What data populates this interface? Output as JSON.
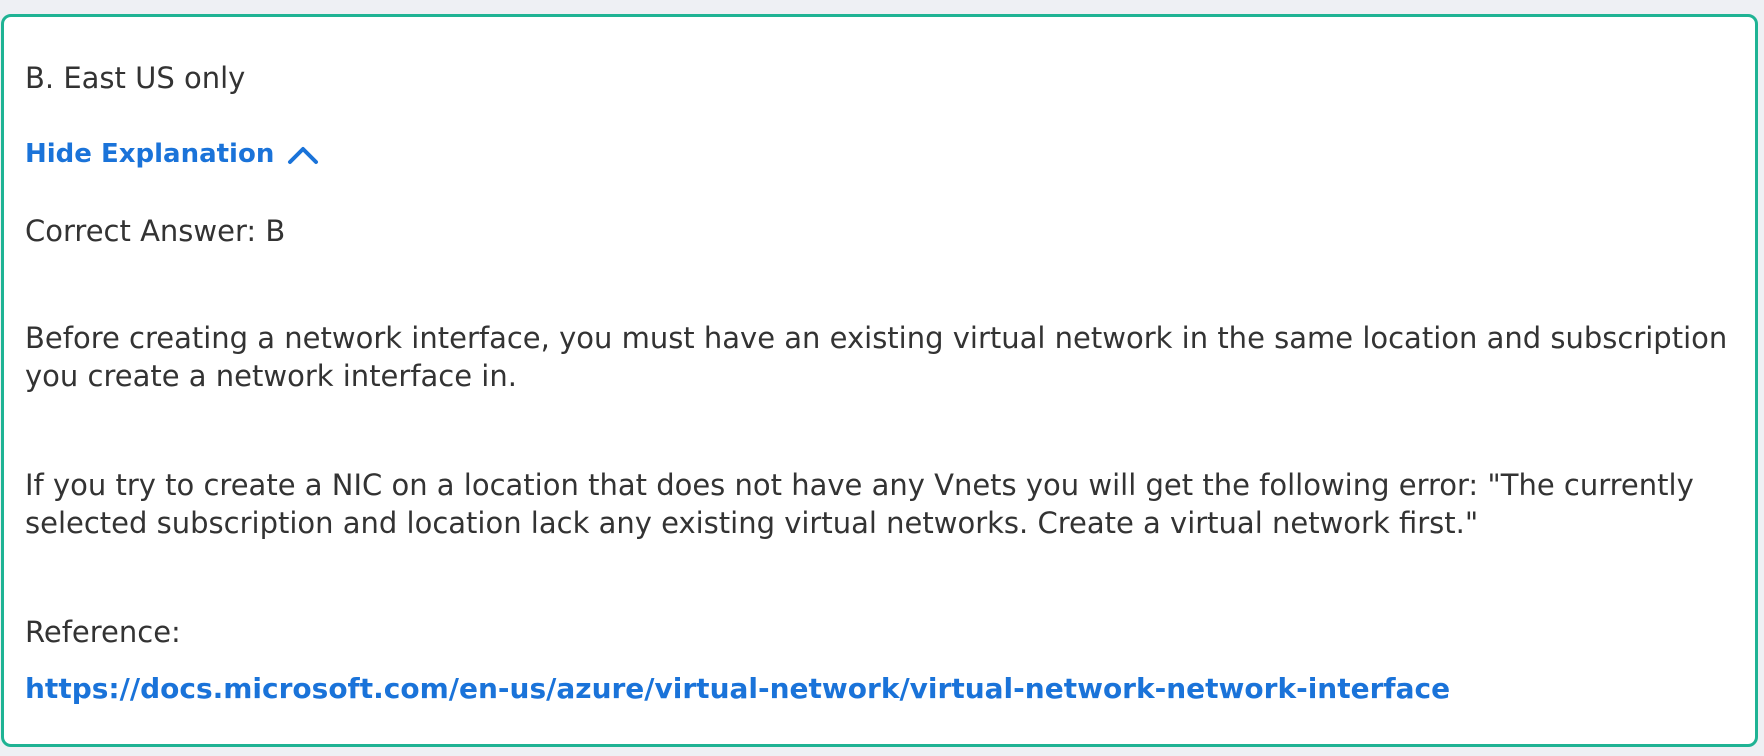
{
  "answer_option": "B. East US only",
  "toggle": {
    "label": "Hide Explanation",
    "icon": "chevron-up-icon"
  },
  "correct_answer": "Correct Answer: B",
  "explanation": {
    "paragraph1": "Before creating a network interface, you must have an existing virtual network in the same location and subscription you create a network interface in.",
    "paragraph2": "If you try to create a NIC on a location that does not have any Vnets you will get the following error: \"The currently selected subscription and location lack any existing virtual networks. Create a virtual network first.\"",
    "reference_label": "Reference:",
    "reference_url": "https://docs.microsoft.com/en-us/azure/virtual-network/virtual-network-network-interface"
  },
  "colors": {
    "border": "#1fb394",
    "link": "#1a73d9",
    "text": "#333333"
  }
}
